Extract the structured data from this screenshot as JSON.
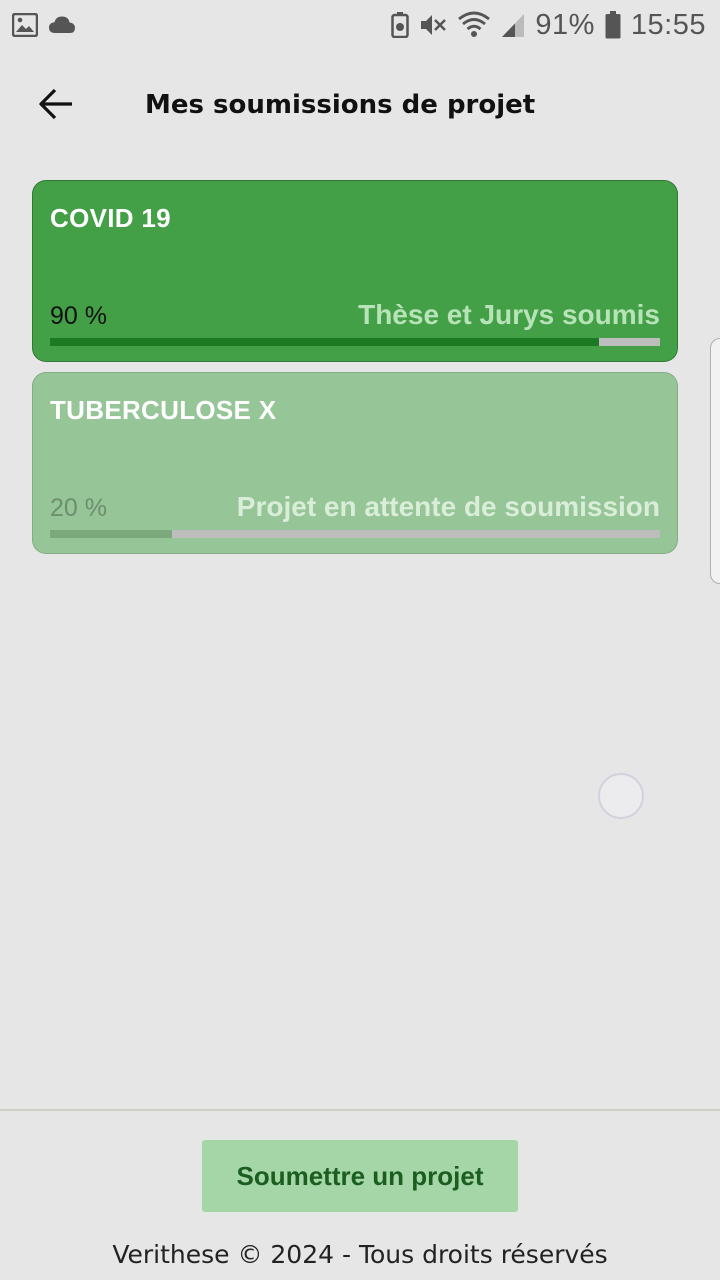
{
  "status_bar": {
    "battery": "91%",
    "time": "15:55",
    "icons_left": [
      "image-icon",
      "cloud-icon"
    ],
    "icons_right": [
      "recycle-battery-icon",
      "mute-icon",
      "wifi-icon",
      "signal-icon",
      "battery-icon"
    ]
  },
  "app_bar": {
    "title": "Mes soumissions de projet",
    "back_icon": "arrow-left-icon"
  },
  "projects": [
    {
      "title": "COVID 19",
      "progress_label": "90 %",
      "status": "Thèse et Jurys soumis",
      "progress": 0.9,
      "color": "#43a047"
    },
    {
      "title": "TUBERCULOSE X",
      "progress_label": "20 %",
      "status": "Projet en attente de soumission",
      "progress": 0.2,
      "color": "#96c597"
    }
  ],
  "submit_label": "Soumettre un projet",
  "footer": "Verithese © 2024 - Tous droits réservés"
}
